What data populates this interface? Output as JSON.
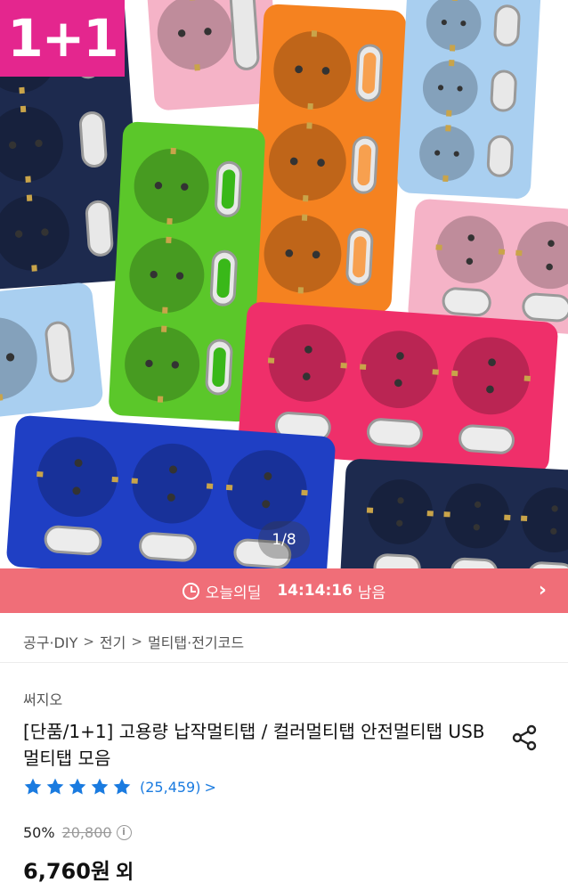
{
  "hero": {
    "badge": "1+1",
    "counter": "1/8",
    "product_colors": {
      "navy": "#1d2a4e",
      "pink": "#f5b3c7",
      "orange": "#f58220",
      "light_blue": "#a9cff0",
      "green": "#5bc72a",
      "hot_pink": "#ef2f6a",
      "blue": "#1f3fc4",
      "badge": "#e4268e"
    }
  },
  "timer": {
    "label": "오늘의딜",
    "time": "14:14:16",
    "suffix": "남음",
    "color": "#f06e78"
  },
  "breadcrumb": [
    "공구·DIY",
    "전기",
    "멀티탭·전기코드"
  ],
  "product": {
    "brand": "써지오",
    "title": "[단품/1+1] 고용량 납작멀티탭 / 컬러멀티탭 안전멀티탭 USB멀티탭 모음",
    "rating_stars": 5,
    "review_count": "(25,459)",
    "discount": "50%",
    "original_price": "20,800",
    "sale_price": "6,760원",
    "sale_suffix": "외",
    "accent": "#1a7be0"
  }
}
